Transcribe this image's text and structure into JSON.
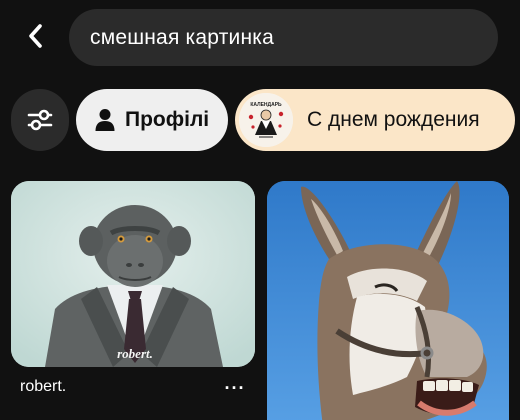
{
  "header": {
    "back_icon": "chevron-left-icon",
    "search_query": "смешная картинка"
  },
  "chips": {
    "filter_icon": "sliders-icon",
    "profiles": {
      "icon": "person-icon",
      "label": "Профілі"
    },
    "birthday": {
      "label": "С днем рождения",
      "thumb_text": "КАЛЕНДАРЬ"
    }
  },
  "pins": [
    {
      "image": "monkey-in-suit",
      "overlay_text": "robert.",
      "caption": "robert.",
      "more_icon": "more-horizontal-icon",
      "more_glyph": "···"
    },
    {
      "image": "laughing-donkey"
    }
  ],
  "colors": {
    "background": "#111111",
    "surface": "#2b2b2b",
    "chip_light": "#efefef",
    "chip_peach": "#fbe6c8",
    "text": "#ffffff"
  }
}
